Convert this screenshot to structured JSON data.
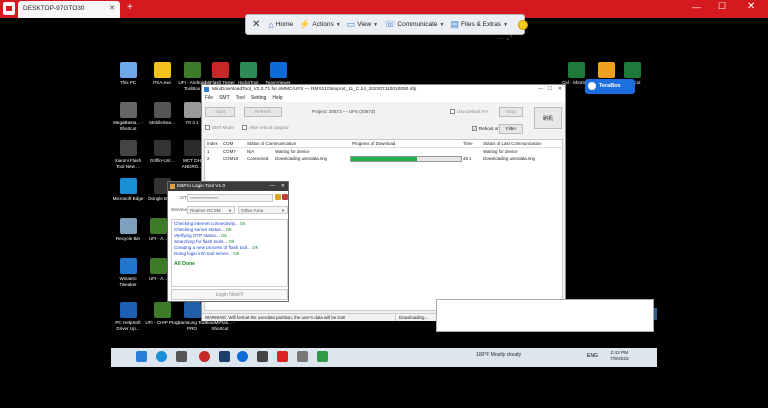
{
  "viewer": {
    "tab_title": "DESKTOP-97GTO30",
    "new_tab": "+",
    "toolbar": {
      "close_glyph": "✕",
      "home": "Home",
      "actions": "Actions",
      "view": "View",
      "communicate": "Communicate",
      "files_extras": "Files & Extras"
    }
  },
  "desktop_icons": [
    {
      "label": "This PC",
      "color": "#6fa8e8"
    },
    {
      "label": "PSA.exe",
      "color": "#f2c21b"
    },
    {
      "label": "UFI - Android ToolBox",
      "color": "#3d7a2a"
    },
    {
      "label": "MiFlash Tester",
      "color": "#c62828"
    },
    {
      "label": "HydraTool",
      "color": "#2e8b57"
    },
    {
      "label": "TeamViewer",
      "color": "#0e6ad6"
    },
    {
      "label": "MegaBasta... - Shortcut",
      "color": "#666666"
    },
    {
      "label": "MobileSea...",
      "color": "#555555"
    },
    {
      "label": "Y0 3.1",
      "color": "#999999"
    },
    {
      "label": "Xiaomi Flash Tool New ...",
      "color": "#444444"
    },
    {
      "label": "Griffin-Unl...",
      "color": "#333333"
    },
    {
      "label": "MCT DH ANDRO...",
      "color": "#2a2a2a"
    },
    {
      "label": "Microsoft Edge",
      "color": "#1b8fd6"
    },
    {
      "label": "Dongle Boost",
      "color": "#333333"
    },
    {
      "label": "Recycle Bin",
      "color": "#7f9fbf"
    },
    {
      "label": "UFI - A...",
      "color": "#3d7a2a"
    },
    {
      "label": "Winaero Tweaker",
      "color": "#2277cc"
    },
    {
      "label": "UFI - A...",
      "color": "#3d7a2a"
    },
    {
      "label": "PC HelpSoft Driver Up...",
      "color": "#1e5fb4"
    },
    {
      "label": "UFI - CHIP Prog",
      "color": "#3d7a2a"
    },
    {
      "label": "Samsung Tool PRO",
      "color": "#2060a8"
    },
    {
      "label": "XiaoMiFlas... - Shortcut",
      "color": "#333333"
    },
    {
      "label": "Csl - Shortcut",
      "color": "#1d7a3a"
    },
    {
      "label": "TeraBox",
      "color": "#f0a020"
    },
    {
      "label": "Shortcut",
      "color": "#1d7a3a"
    }
  ],
  "terabox_label": "TeraBox",
  "flash_tool": {
    "title": "MiniDownloadTool_V2.0.71 for eMMC/UFS — RMX2103export_11_C.14_202207110010050.ofp",
    "menu": [
      "File",
      "SMT",
      "Tool",
      "Setting",
      "Help"
    ],
    "start": "Start",
    "refresh": "Refresh",
    "project": "Project: 20673 --- UFS (20673)",
    "use_default_fit": "Use Default FH",
    "stop": "Stop",
    "smt_mode": "SMT Mode",
    "after_reboot": "After reboot Upgrad",
    "reboot_on_finish": "Reboot on Finish",
    "filter": "Filter",
    "brand": "刷机",
    "columns": [
      "Index",
      "COM",
      "Status of Communication",
      "Progress of Download",
      "Time",
      "Status of Last Communication"
    ],
    "rows": [
      {
        "index": "1",
        "com": "COM7",
        "status": "N/A",
        "comm": "Waiting for device",
        "progress": 0,
        "time": "",
        "last": "Waiting for device"
      },
      {
        "index": "2",
        "com": "COM10",
        "status": "Connected",
        "comm": "Downloading userdata.img",
        "progress": 0.6,
        "time": "48 s",
        "last": "Downloading userdata.img"
      }
    ],
    "status_bar": [
      "WARNING: Will format the userdata partition, the user's data will be lost!",
      "Downloading...",
      "Internet/Online",
      "Readback Verify"
    ]
  },
  "login_tool": {
    "title": "EBPro Login Tool V1.0",
    "otp_label": "OTP :",
    "otp_value": "****************",
    "service_label": "Service :",
    "service_value": "Realme RCSM",
    "other_area": "Other Area",
    "log": [
      {
        "text": "Checking internet connectivity...",
        "ok": "Ok"
      },
      {
        "text": "Checking server status...",
        "ok": "Ok"
      },
      {
        "text": "Verifying OTP status...",
        "ok": "Ok"
      },
      {
        "text": "Searching for flash tools...",
        "ok": "Ok"
      },
      {
        "text": "Creating a new process of flash tool...",
        "ok": "Ok"
      },
      {
        "text": "Doing login into tool server...",
        "ok": "Ok"
      }
    ],
    "all_done": "All Done",
    "login_button": "Login Now!!!"
  },
  "taskbar": {
    "weather": "100°F  Mostly cloudy",
    "lang": "ENG",
    "time": "2:42 PM",
    "date": "7/9/2023"
  }
}
